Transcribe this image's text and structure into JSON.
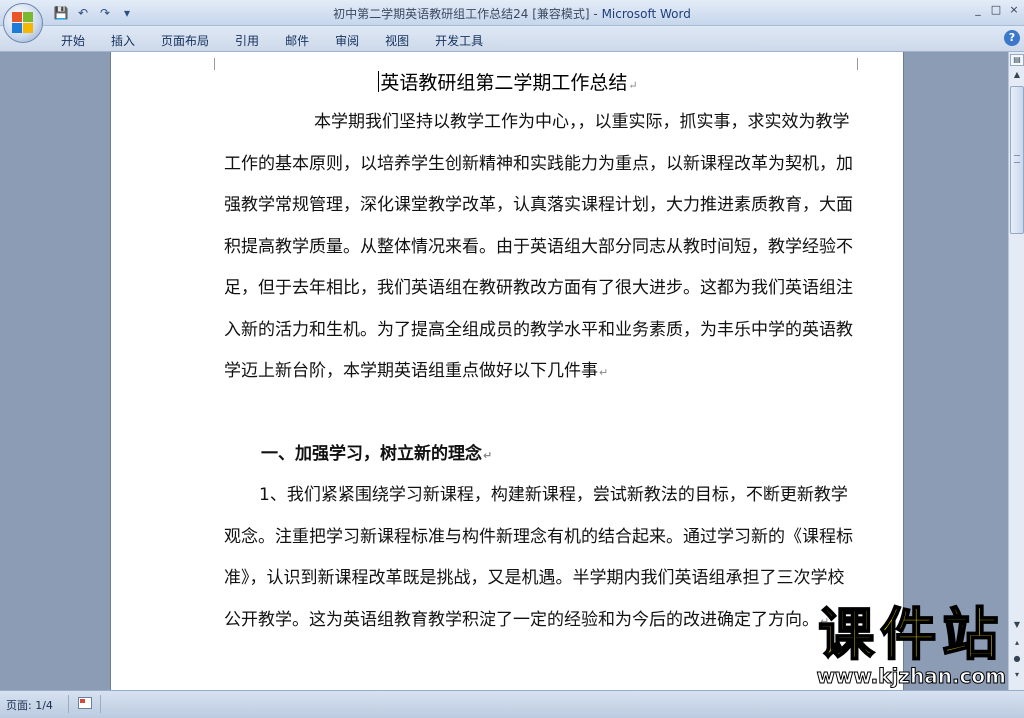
{
  "window": {
    "title": "初中第二学期英语教研组工作总结24 [兼容模式]",
    "title_separator": " - ",
    "app_name": "Microsoft Word",
    "controls": [
      "_",
      "□",
      "×"
    ]
  },
  "quick_access": [
    {
      "icon": "save-icon",
      "glyph": "💾"
    },
    {
      "icon": "undo-icon",
      "glyph": "↶"
    },
    {
      "icon": "redo-icon",
      "glyph": "↷"
    },
    {
      "icon": "customize-icon",
      "glyph": "▾"
    }
  ],
  "ribbon": {
    "tabs": [
      "开始",
      "插入",
      "页面布局",
      "引用",
      "邮件",
      "审阅",
      "视图",
      "开发工具"
    ],
    "help_glyph": "?"
  },
  "document": {
    "title": "英语教研组第二学期工作总结",
    "paragraph_mark": "↵",
    "paragraph1": "本学期我们坚持以教学工作为中心，，以重实际，抓实事，求实效为教学工作的基本原则，以培养学生创新精神和实践能力为重点，以新课程改革为契机，加强教学常规管理，深化课堂教学改革，认真落实课程计划，大力推进素质教育，大面积提高教学质量。从整体情况来看。由于英语组大部分同志从教时间短，教学经验不足，但于去年相比，我们英语组在教研教改方面有了很大进步。这都为我们英语组注入新的活力和生机。为了提高全组成员的教学水平和业务素质，为丰乐中学的英语教学迈上新台阶，本学期英语组重点做好以下几件事",
    "heading1": "一、加强学习，树立新的理念",
    "paragraph2": "1、我们紧紧围绕学习新课程，构建新课程，尝试新教法的目标，不断更新教学观念。注重把学习新课程标准与构件新理念有机的结合起来。通过学习新的《课程标准》，认识到新课程改革既是挑战，又是机遇。半学期内我们英语组承担了三次学校公开教学。这为英语组教育教学积淀了一定的经验和为今后的改进确定了方向。"
  },
  "watermark": {
    "text": "课件站",
    "url": "www.kjzhan.com"
  },
  "statusbar": {
    "page": "页面: 1/4"
  },
  "colors": {
    "titlebar": "#c7d6ec",
    "app_name": "#1f3f7a",
    "watermark_yellow": "#f4e300",
    "doc_background": "#8c9cb5"
  }
}
